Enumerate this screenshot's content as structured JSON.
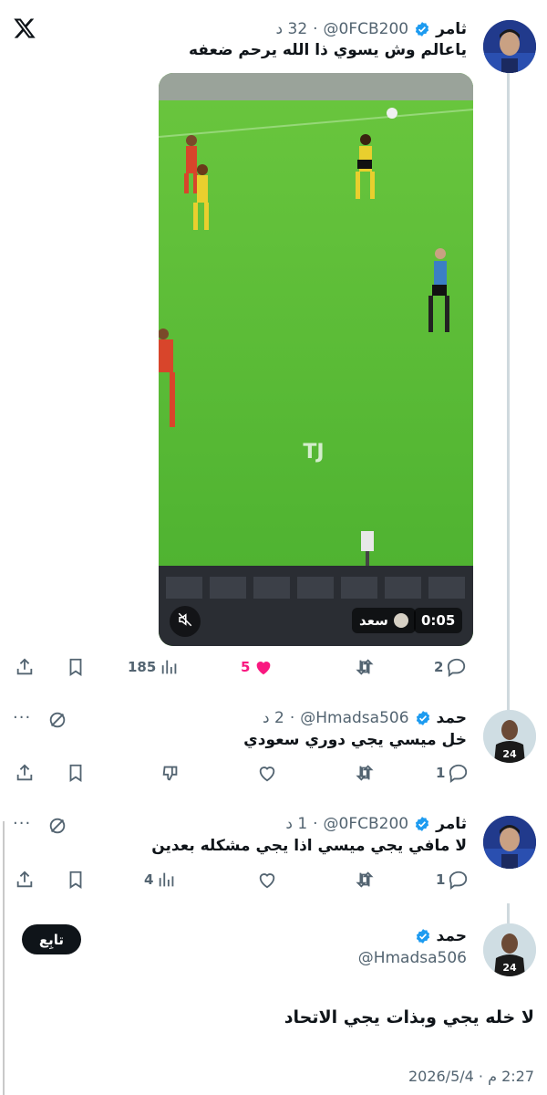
{
  "app": {
    "logo": "x-logo"
  },
  "tweets": [
    {
      "name": "ثامر",
      "handle": "@0FCB200",
      "time": "32 د",
      "text": "ياعالم وش يسوي ذا الله يرحم ضعفه",
      "video": {
        "duration": "0:05",
        "uploader": "سعد",
        "watermark": "TJ"
      },
      "actions": {
        "replies": "2",
        "retweets": "",
        "likes": "5",
        "views": "185"
      }
    },
    {
      "name": "حمد",
      "handle": "@Hmadsa506",
      "time": "2 د",
      "text": "خل ميسي يجي دوري سعودي",
      "actions": {
        "replies": "1",
        "views": ""
      }
    },
    {
      "name": "ثامر",
      "handle": "@0FCB200",
      "time": "1 د",
      "text": "لا مافي يجي ميسي اذا يجي مشكله بعدين",
      "actions": {
        "replies": "1",
        "views": "4"
      }
    }
  ],
  "main_tweet": {
    "name": "حمد",
    "handle": "@Hmadsa506",
    "follow_label": "تابِع",
    "text": "لا خله يجي وبذات يجي الاتحاد",
    "timestamp": "2:27 م · 2026/5/4"
  },
  "colors": {
    "verified": "#1d9bf0",
    "like": "#f91880",
    "text": "#0f1419",
    "muted": "#536471"
  }
}
